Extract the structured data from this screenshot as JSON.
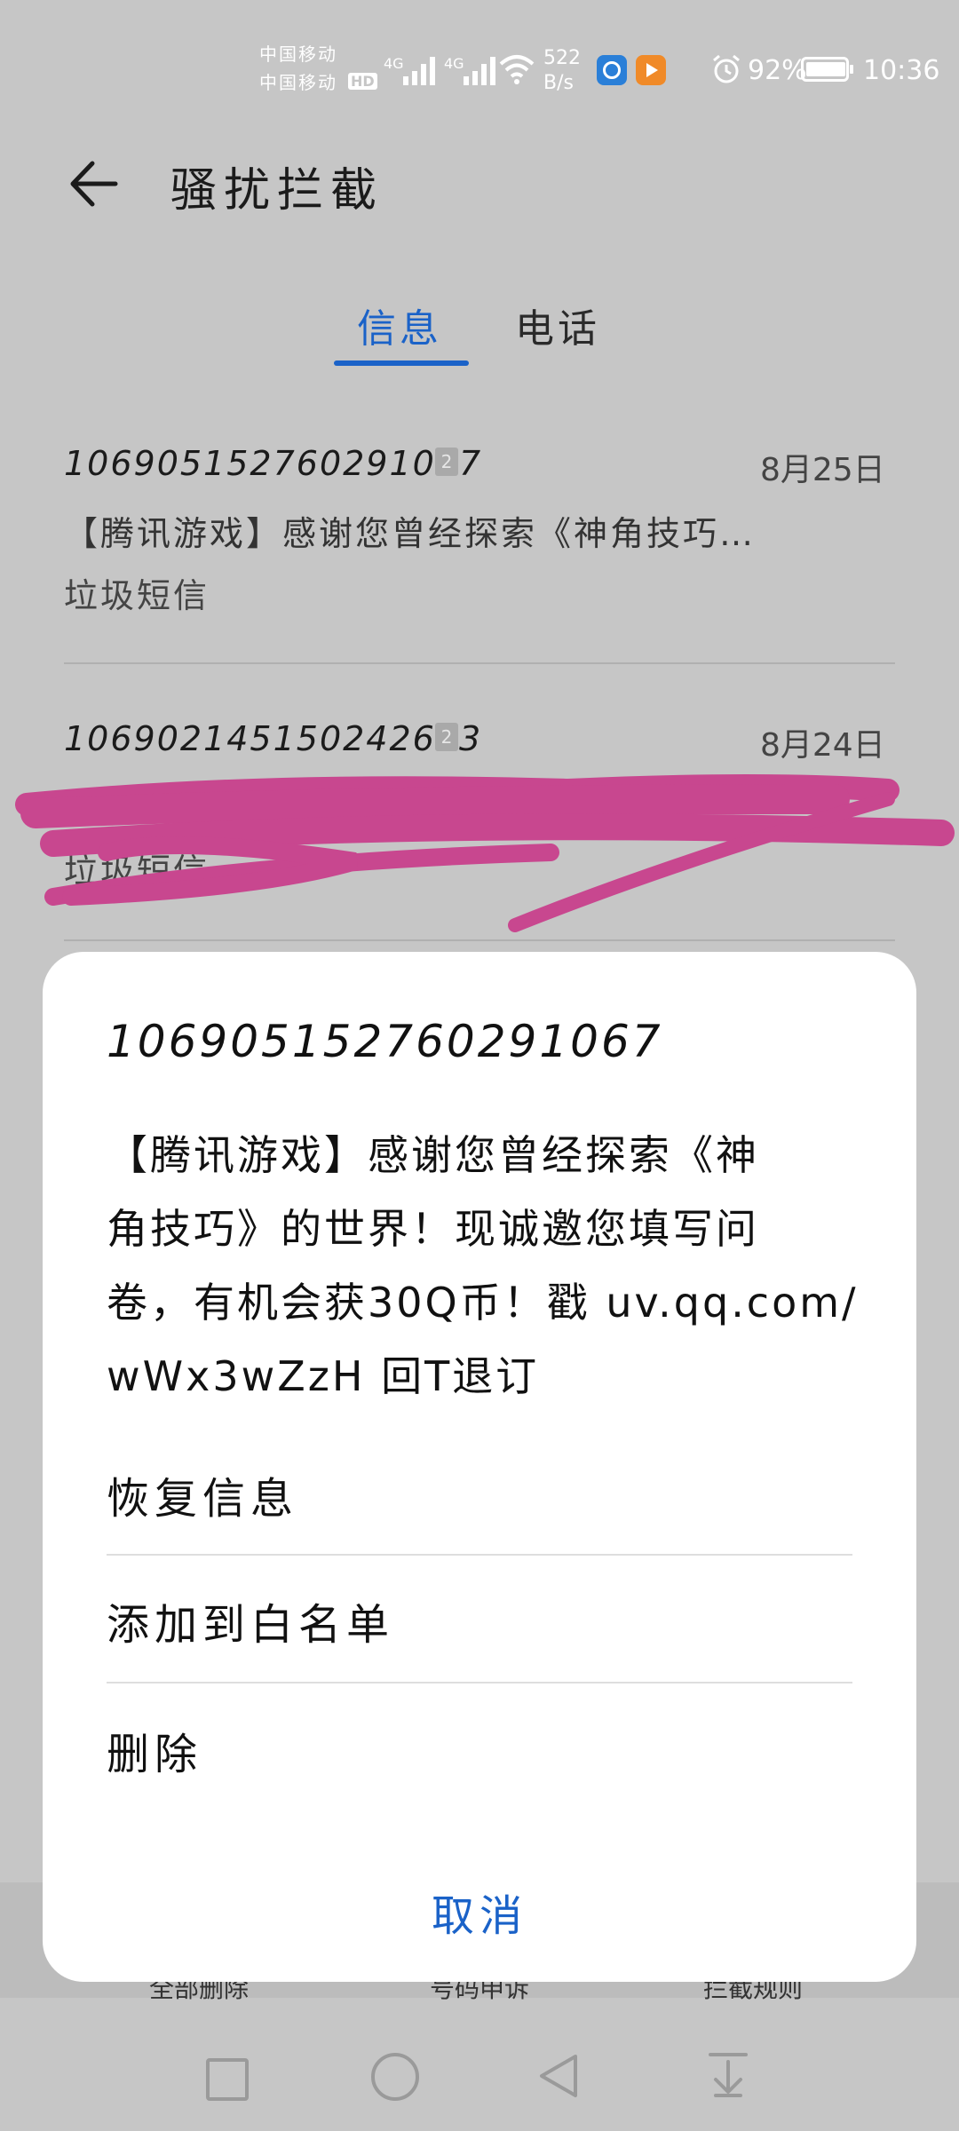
{
  "status_bar": {
    "carrier_1": "中国移动",
    "carrier_2": "中国移动",
    "hd": "HD",
    "net_1": "4G",
    "net_2": "4G",
    "speed_value": "522",
    "speed_unit": "B/s",
    "battery": "92%",
    "time": "10:36"
  },
  "header": {
    "title": "骚扰拦截"
  },
  "tabs": [
    {
      "label": "信息",
      "active": true
    },
    {
      "label": "电话",
      "active": false
    }
  ],
  "messages": [
    {
      "number": "106905152760291067",
      "sim": "2",
      "date": "8月25日",
      "preview": "【腾讯游戏】感谢您曾经探索《神角技巧…",
      "tag": "垃圾短信"
    },
    {
      "number": "106902145150242673",
      "sim": "2",
      "date": "8月24日",
      "tag": "垃圾短信"
    }
  ],
  "bottom_bar": {
    "items": [
      "全部删除",
      "号码申诉",
      "拦截规则"
    ]
  },
  "dialog": {
    "number": "106905152760291067",
    "body_lines": [
      "【腾讯游戏】感谢您曾经探索《神",
      "角技巧》的世界！现诚邀您填写问",
      "卷，有机会获30Q币！戳 uv.qq.com/",
      "wWx3wZzH 回T退订"
    ],
    "actions": [
      "恢复信息",
      "添加到白名单",
      "删除"
    ],
    "cancel": "取消"
  },
  "colors": {
    "accent": "#1a62c8",
    "scrim_background": "#c6c6c6",
    "redaction_scribble": "#c8478f"
  },
  "icons": [
    "back-arrow-icon",
    "alarm-icon",
    "battery-icon",
    "wifi-icon",
    "signal-icon",
    "square-nav-icon",
    "circle-nav-icon",
    "triangle-nav-icon",
    "notification-pull-icon"
  ]
}
